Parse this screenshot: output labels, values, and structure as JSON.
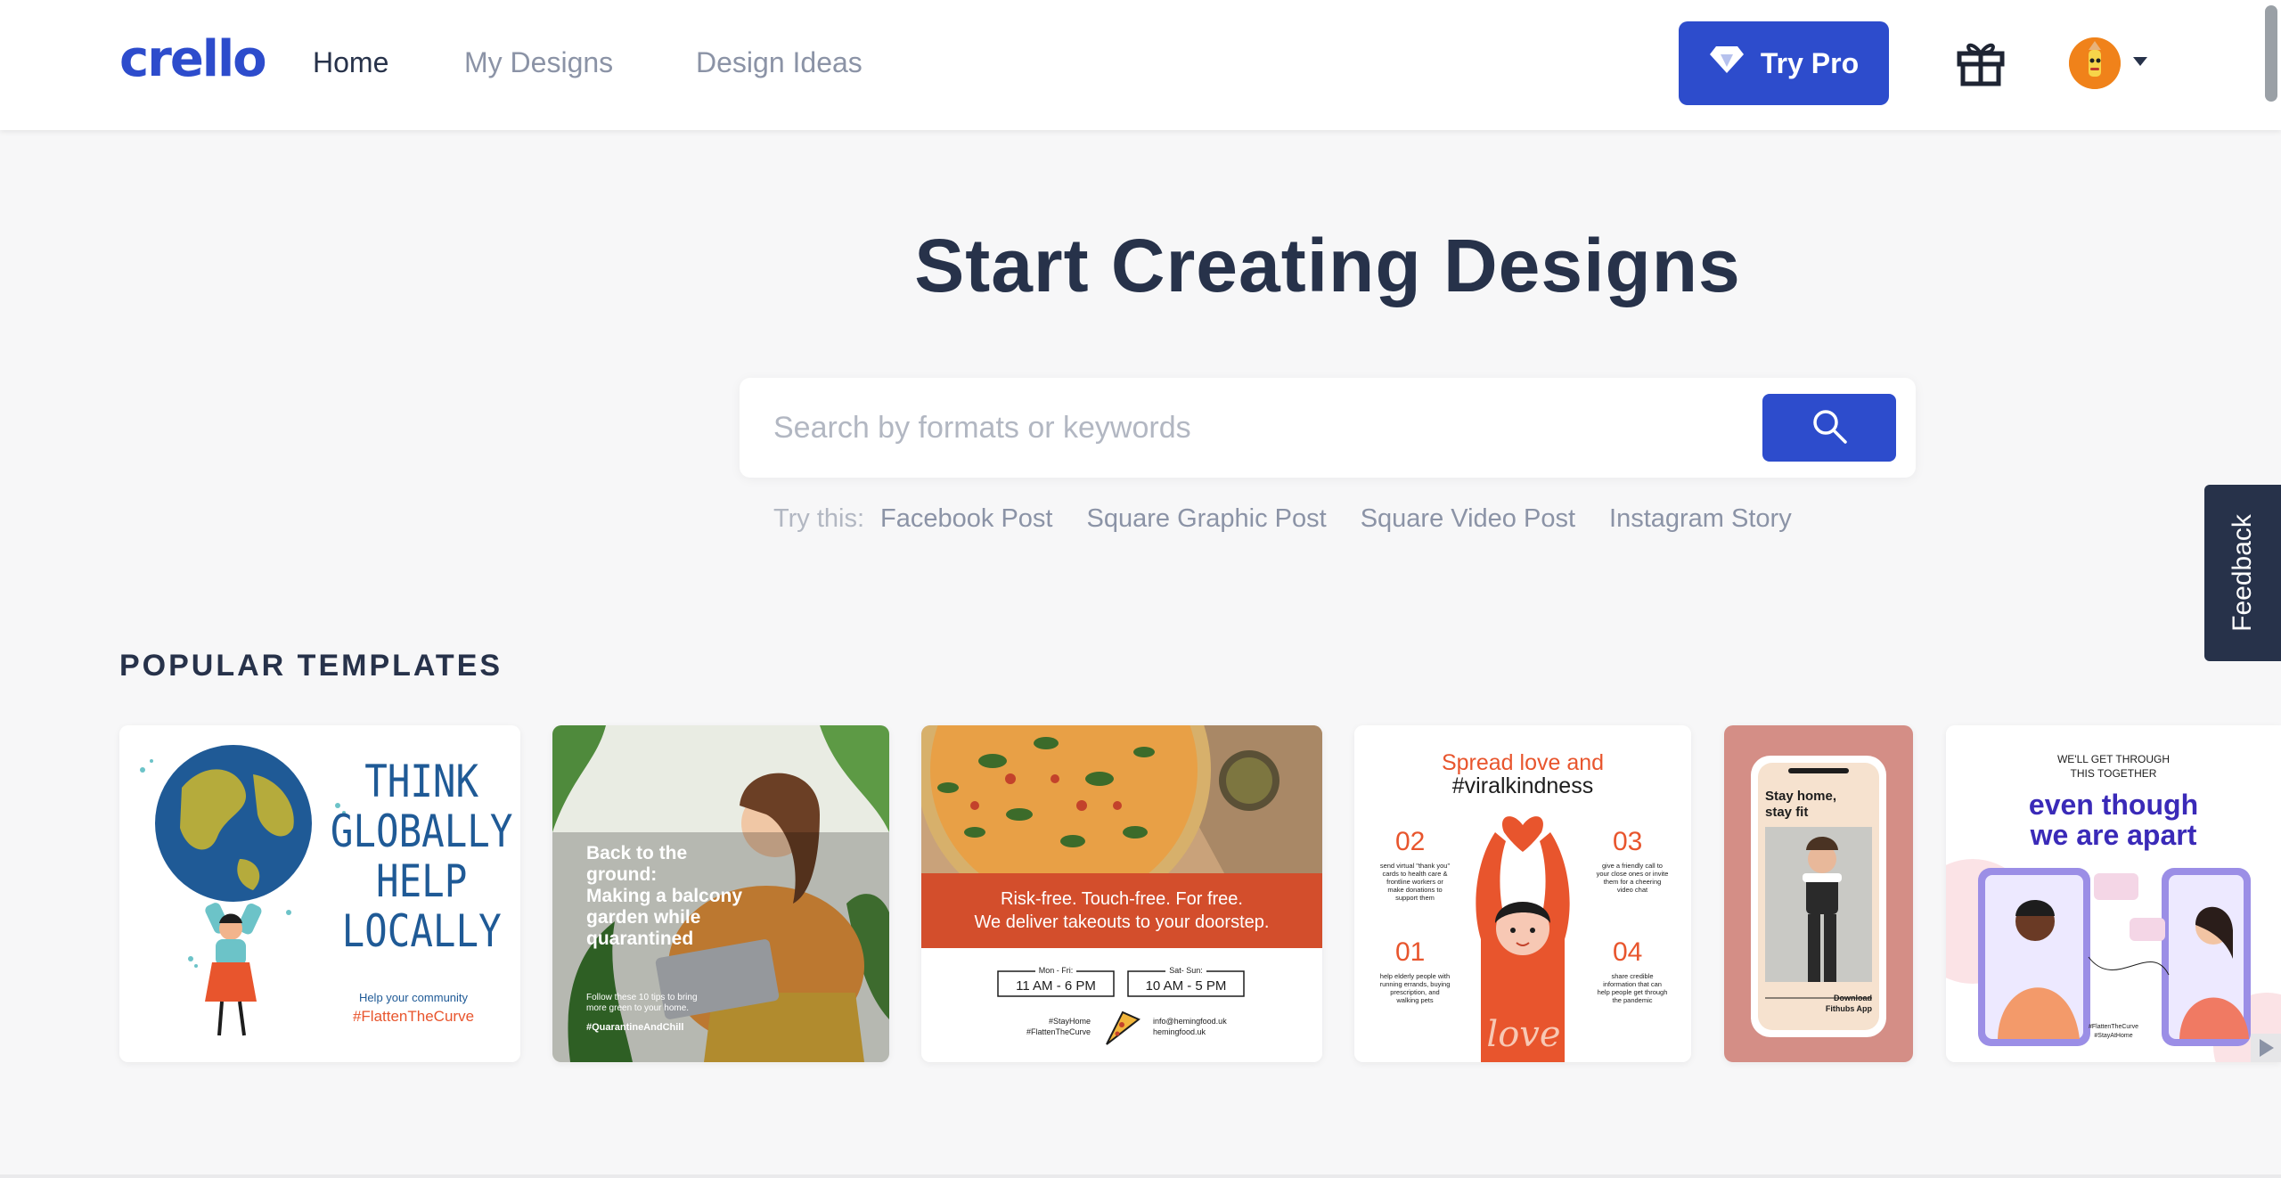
{
  "header": {
    "logo": "crello",
    "nav": [
      "Home",
      "My Designs",
      "Design Ideas"
    ],
    "try_pro": "Try Pro"
  },
  "hero": {
    "title": "Start Creating Designs",
    "search_placeholder": "Search by formats or keywords",
    "try_label": "Try this:",
    "try_links": [
      "Facebook Post",
      "Square Graphic Post",
      "Square Video Post",
      "Instagram Story"
    ]
  },
  "feedback": "Feedback",
  "popular": {
    "title": "POPULAR TEMPLATES",
    "cards": [
      {
        "lines": [
          "THINK",
          "GLOBALLY",
          "HELP",
          "LOCALLY"
        ],
        "sub": "Help your community",
        "tag": "#FlattenTheCurve"
      },
      {
        "lines": [
          "Back to the",
          "ground:",
          "Making a balcony",
          "garden while",
          "quarantined"
        ],
        "sub1": "Follow these 10 tips to bring",
        "sub2": "more green to your home.",
        "tag": "#QuarantineAndChill"
      },
      {
        "line1": "Risk-free. Touch-free. For free.",
        "line2": "We deliver takeouts to your doorstep.",
        "hours1_label": "Mon - Fri:",
        "hours1": "11 AM - 6 PM",
        "hours2_label": "Sat- Sun:",
        "hours2": "10 AM - 5 PM",
        "tag1": "#StayHome",
        "tag2": "#FlattenTheCurve",
        "contact1": "info@hemingfood.uk",
        "contact2": "hemingfood.uk"
      },
      {
        "title1": "Spread love and",
        "title2": "#viralkindness",
        "n1": "02",
        "t1": [
          "send virtual \"thank you\"",
          "cards to health care &",
          "frontline workers or",
          "make donations to",
          "support them"
        ],
        "n2": "03",
        "t2": [
          "give a friendly call to",
          "your close ones or invite",
          "them for a cheering",
          "video chat"
        ],
        "n3": "01",
        "t3": [
          "help elderly people with",
          "running errands, buying",
          "prescription, and",
          "walking pets"
        ],
        "n4": "04",
        "t4": [
          "share credible",
          "information that can",
          "help people get through",
          "the pandemic"
        ],
        "love": "love"
      },
      {
        "title1": "Stay home,",
        "title2": "stay fit",
        "cta1": "Download",
        "cta2": "Fithubs App"
      },
      {
        "top1": "WE'LL GET THROUGH",
        "top2": "THIS TOGETHER",
        "big1": "even though",
        "big2": "we are apart",
        "tag1": "#FlattenTheCurve",
        "tag2": "#StayAtHome"
      }
    ]
  }
}
